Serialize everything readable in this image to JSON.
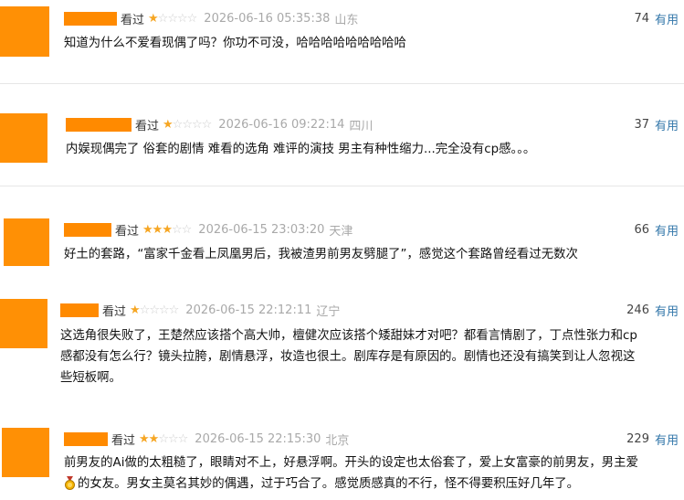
{
  "reviews": [
    {
      "watched": "看过",
      "stars": [
        "★",
        "☆",
        "☆",
        "☆",
        "☆"
      ],
      "datetime": "2026-06-16 05:35:38",
      "location": "山东",
      "votes": "74",
      "useful": "有用",
      "text": "知道为什么不爱看现偶了吗？你功不可没，哈哈哈哈哈哈哈哈哈"
    },
    {
      "watched": "看过",
      "stars": [
        "★",
        "☆",
        "☆",
        "☆",
        "☆"
      ],
      "datetime": "2026-06-16 09:22:14",
      "location": "四川",
      "votes": "37",
      "useful": "有用",
      "text": "内娱现偶完了 俗套的剧情 难看的选角 难评的演技 男主有种性缩力...完全没有cp感。。。"
    },
    {
      "watched": "看过",
      "stars": [
        "★",
        "★",
        "★",
        "☆",
        "☆"
      ],
      "datetime": "2026-06-15 23:03:20",
      "location": "天津",
      "votes": "66",
      "useful": "有用",
      "text": "好土的套路，“富家千金看上凤凰男后，我被渣男前男友劈腿了”，感觉这个套路曾经看过无数次"
    },
    {
      "watched": "看过",
      "stars": [
        "★",
        "☆",
        "☆",
        "☆",
        "☆"
      ],
      "datetime": "2026-06-15 22:12:11",
      "location": "辽宁",
      "votes": "246",
      "useful": "有用",
      "text_lines": [
        "这选角很失败了，王楚然应该搭个高大帅，檀健次应该搭个矮甜妹才对吧？都看言情剧了，丁点性张力和cp",
        "感都没有怎么行？镜头拉胯，剧情悬浮，妆造也很土。剧库存是有原因的。剧情也还没有搞笑到让人忽视这",
        "些短板啊。"
      ]
    },
    {
      "watched": "看过",
      "stars": [
        "★",
        "★",
        "☆",
        "☆",
        "☆"
      ],
      "datetime": "2026-06-15 22:15:30",
      "location": "北京",
      "votes": "229",
      "useful": "有用",
      "text_lines": [
        "前男友的Ai做的太粗糙了，眼睛对不上，好悬浮啊。开头的设定也太俗套了，爱上女富豪的前男友，男主爱",
        "的女友。男女主莫名其妙的偶遇，过于巧合了。感觉质感真的不行，怪不得要积压好几年了。"
      ]
    }
  ],
  "colors": {
    "avatar": "#ff9005",
    "star_on": "#f6a623",
    "star_off": "#cfcfcf",
    "useful": "#3377aa",
    "meta": "#a9a9a9"
  }
}
